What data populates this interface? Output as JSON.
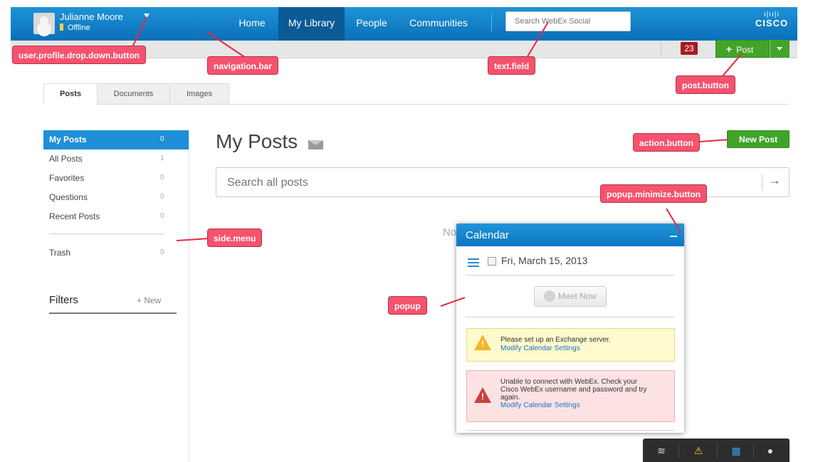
{
  "header": {
    "user_name": "Julianne Moore",
    "user_status": "Offline",
    "nav": [
      {
        "label": "Home",
        "active": false
      },
      {
        "label": "My Library",
        "active": true
      },
      {
        "label": "People",
        "active": false
      },
      {
        "label": "Communities",
        "active": false
      }
    ],
    "search_placeholder": "Search WebEx Social",
    "brand": "CISCO",
    "notification_count": "23",
    "post_label": "Post"
  },
  "tabs": [
    {
      "label": "Posts",
      "active": true
    },
    {
      "label": "Documents",
      "active": false
    },
    {
      "label": "Images",
      "active": false
    }
  ],
  "side_menu": {
    "items": [
      {
        "label": "My Posts",
        "count": "0",
        "selected": true
      },
      {
        "label": "All Posts",
        "count": "1",
        "selected": false
      },
      {
        "label": "Favorites",
        "count": "0",
        "selected": false
      },
      {
        "label": "Questions",
        "count": "0",
        "selected": false
      },
      {
        "label": "Recent Posts",
        "count": "0",
        "selected": false
      }
    ],
    "trash": {
      "label": "Trash",
      "count": "0"
    },
    "filters_label": "Filters",
    "new_filter_label": "New"
  },
  "main": {
    "title": "My Posts",
    "new_post_label": "New Post",
    "search_placeholder": "Search all posts",
    "empty_text": "No"
  },
  "calendar_popup": {
    "title": "Calendar",
    "date": "Fri, March 15, 2013",
    "meet_now_label": "Meet Now",
    "warning_text": "Please set up an Exchange server.",
    "warning_link": "Modify Calendar Settings",
    "error_text_1": "Unable to connect with WebEx. Check your",
    "error_text_2": "Cisco WebEx username and password and try",
    "error_text_3": "again.",
    "error_link": "Modify Calendar Settings"
  },
  "annotations": {
    "profile": "user.profile.drop.down.button",
    "navigation": "navigation.bar",
    "text_field": "text.field",
    "post_button": "post.button",
    "action_button": "action.button",
    "popup_minimize": "popup.minimize.button",
    "side_menu": "side.menu",
    "popup": "popup",
    "color": "#f4536e"
  },
  "icons": {
    "toolbar": [
      "activity-stream-icon",
      "chat-alert-icon",
      "calendar-icon",
      "contact-icon"
    ],
    "search_submit": "arrow-right-icon",
    "email": "envelope-icon"
  }
}
